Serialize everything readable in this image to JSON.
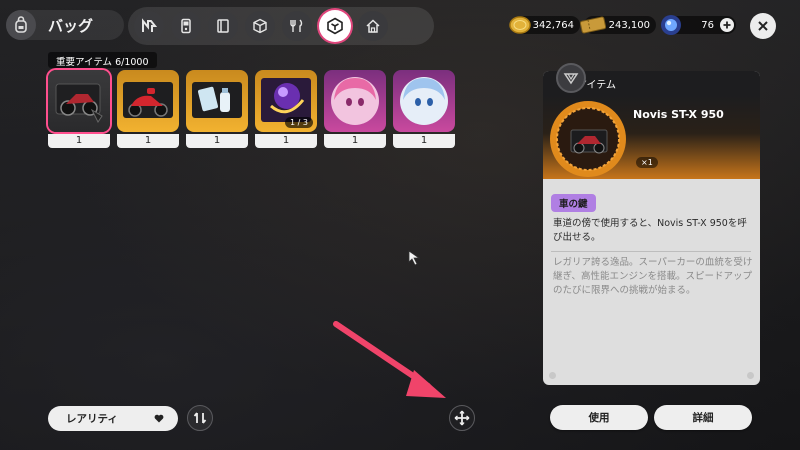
{
  "header": {
    "title": "バッグ",
    "back_icon": "backpack-icon"
  },
  "tabs": [
    {
      "name": "tab-n",
      "icon": "n-logo-icon"
    },
    {
      "name": "tab-device",
      "icon": "handheld-device-icon"
    },
    {
      "name": "tab-book",
      "icon": "book-icon"
    },
    {
      "name": "tab-box",
      "icon": "box-icon"
    },
    {
      "name": "tab-food",
      "icon": "fork-knife-icon"
    },
    {
      "name": "tab-key-items",
      "icon": "key-item-icon",
      "active": true
    },
    {
      "name": "tab-home",
      "icon": "home-icon"
    }
  ],
  "currencies": {
    "gold": "342,764",
    "ticket": "243,100",
    "gem": "76"
  },
  "inventory": {
    "label": "重要アイテム 6/1000",
    "items": [
      {
        "name": "motorcycle-item",
        "qty": "1",
        "rarity": "gold",
        "selected": true
      },
      {
        "name": "scooter-item",
        "qty": "1",
        "rarity": "gold"
      },
      {
        "name": "supplies-item",
        "qty": "1",
        "rarity": "gold"
      },
      {
        "name": "purple-orb-item",
        "qty": "1",
        "rarity": "gold",
        "badge": "1 / 3"
      },
      {
        "name": "pink-hair-character-item",
        "qty": "1",
        "rarity": "purple"
      },
      {
        "name": "blue-hair-character-item",
        "qty": "1",
        "rarity": "purple"
      }
    ]
  },
  "detail": {
    "header": "アイテム",
    "item_name": "Novis ST-X 950",
    "qty": "×1",
    "tag": "車の鍵",
    "description": "車道の傍で使用すると、Novis ST-X 950を呼び出せる。",
    "lore": "レガリア誇る逸品。スーパーカーの血統を受け継ぎ、高性能エンジンを搭載。スピードアップのたびに限界への挑戦が始まる。",
    "use_button": "使用",
    "detail_button": "詳細"
  },
  "footer": {
    "sort_label": "レアリティ"
  },
  "colors": {
    "accent_pink": "#e0467c",
    "gold_frame": "#f2b230",
    "purple_frame": "#c9499e",
    "tag_purple": "#b07fe3",
    "arrow": "#f0446a"
  }
}
